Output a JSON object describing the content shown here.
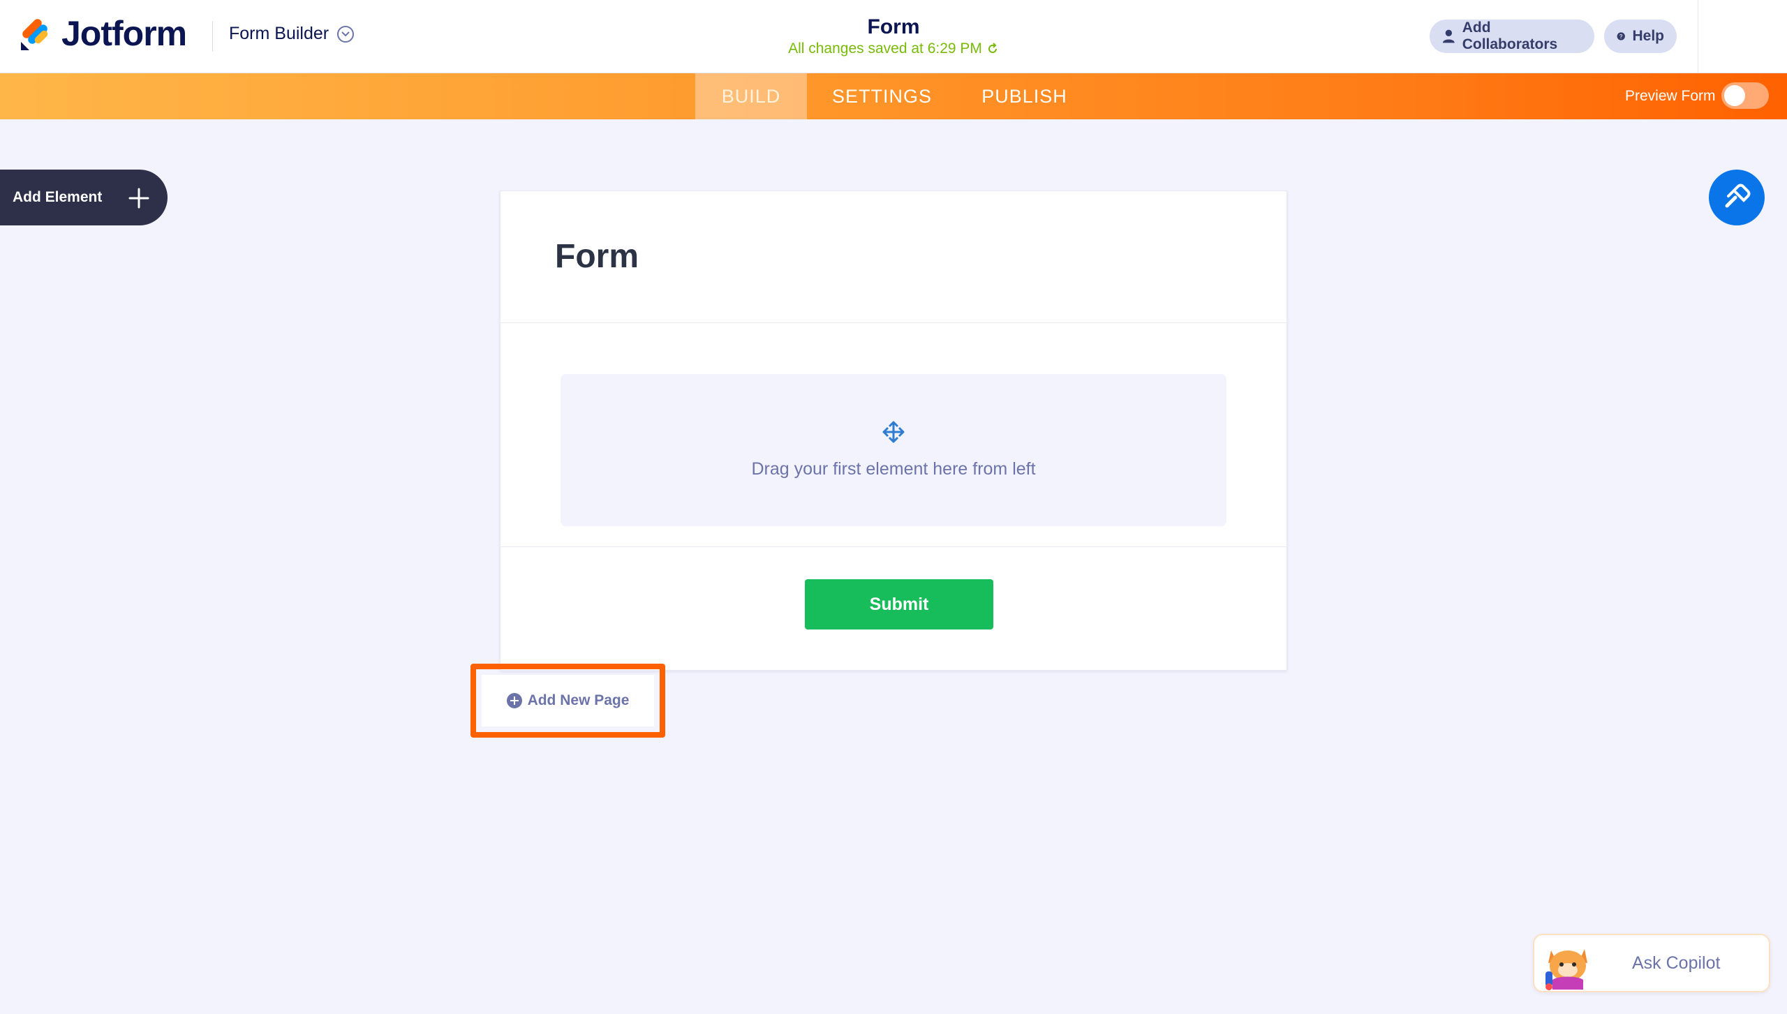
{
  "header": {
    "brand": "Jotform",
    "builder_switch": "Form Builder",
    "form_name": "Form",
    "save_status": "All changes saved at 6:29 PM",
    "add_collaborators": "Add Collaborators",
    "help": "Help"
  },
  "nav": {
    "tabs": [
      {
        "label": "BUILD",
        "active": true
      },
      {
        "label": "SETTINGS",
        "active": false
      },
      {
        "label": "PUBLISH",
        "active": false
      }
    ],
    "preview_label": "Preview Form",
    "preview_on": false
  },
  "sidebar": {
    "add_element": "Add Element"
  },
  "form": {
    "title": "Form",
    "dropzone_text": "Drag your first element here from left",
    "submit_label": "Submit"
  },
  "add_page_label": "Add New Page",
  "copilot_label": "Ask Copilot",
  "colors": {
    "accent_orange": "#ff6100",
    "submit_green": "#18bd5b",
    "save_green": "#78bb07",
    "design_blue": "#0975e9",
    "navy": "#0a1551"
  }
}
